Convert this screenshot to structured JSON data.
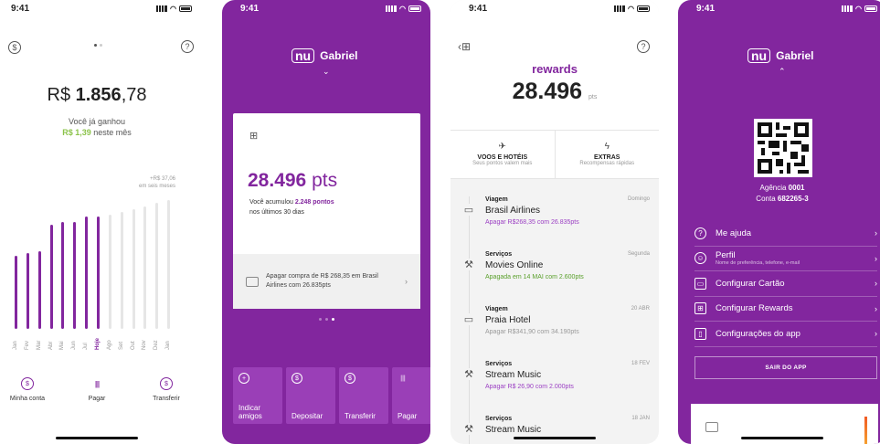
{
  "status_time": "9:41",
  "screen1": {
    "balance_prefix": "R$ ",
    "balance_int": "1.856",
    "balance_dec": ",78",
    "earned_label": "Você já ganhou",
    "earned_value": "R$ 1,39",
    "earned_suffix": " neste mês",
    "projection_value": "+R$ 37,06",
    "projection_label": "em seis meses",
    "months": [
      "Jan",
      "Fev",
      "Mar",
      "Abr",
      "Mai",
      "Jun",
      "Jul",
      "Hoje",
      "Ago",
      "Set",
      "Out",
      "Nov",
      "Dez",
      "Jan"
    ],
    "bar_levels": [
      0.5,
      0.52,
      0.53,
      0.71,
      0.73,
      0.73,
      0.77,
      0.77,
      0.78,
      0.8,
      0.82,
      0.84,
      0.86,
      0.88
    ],
    "actions": [
      {
        "label": "Minha conta",
        "icon": "wallet-icon",
        "glyph": "$"
      },
      {
        "label": "Pagar",
        "icon": "barcode-icon",
        "glyph": "||||"
      },
      {
        "label": "Transferir",
        "icon": "transfer-icon",
        "glyph": "$"
      }
    ]
  },
  "screen2": {
    "name": "Gabriel",
    "points": "28.496",
    "points_unit": "pts",
    "accum_prefix": "Você acumulou ",
    "accum_value": "2.248 pontos",
    "accum_suffix": "nos últimos 30 dias",
    "footer_text": "Apagar compra de R$ 268,35 em Brasil Airlines com 26.835pts",
    "tiles": [
      {
        "label": "Indicar amigos",
        "icon": "add-user-icon"
      },
      {
        "label": "Depositar",
        "icon": "deposit-icon"
      },
      {
        "label": "Transferir",
        "icon": "transfer-icon"
      },
      {
        "label": "Pagar",
        "icon": "barcode-icon"
      }
    ]
  },
  "screen3": {
    "title": "rewards",
    "points": "28.496",
    "points_unit": "pts",
    "categories": [
      {
        "title": "VOOS E HOTÉIS",
        "sub": "Seus pontos valem mais",
        "icon": "airplane-icon",
        "glyph": "✈"
      },
      {
        "title": "EXTRAS",
        "sub": "Recompensas rápidas",
        "icon": "lightning-icon",
        "glyph": "ϟ"
      }
    ],
    "feed": [
      {
        "category": "Viagem",
        "name": "Brasil Airlines",
        "detail": "Apagar R$268,35 com 26.835pts",
        "date": "Domingo",
        "tone": "purple",
        "icon": "suitcase-icon"
      },
      {
        "category": "Serviços",
        "name": "Movies Online",
        "detail": "Apagada em 14 MAI com 2.600pts",
        "date": "Segunda",
        "tone": "green",
        "icon": "tools-icon"
      },
      {
        "category": "Viagem",
        "name": "Praia Hotel",
        "detail": "Apagar R$341,90 com 34.190pts",
        "date": "20 ABR",
        "tone": "gray",
        "icon": "suitcase-icon"
      },
      {
        "category": "Serviços",
        "name": "Stream Music",
        "detail": "Apagar R$ 26,90 com 2.000pts",
        "date": "18 FEV",
        "tone": "purple",
        "icon": "tools-icon"
      },
      {
        "category": "Serviços",
        "name": "Stream Music",
        "detail": "",
        "date": "18 JAN",
        "tone": "gray",
        "icon": "tools-icon"
      }
    ]
  },
  "screen4": {
    "name": "Gabriel",
    "agency_label": "Agência ",
    "agency": "0001",
    "account_label": "Conta ",
    "account": "682265-3",
    "menu": [
      {
        "label": "Me ajuda",
        "sub": "",
        "icon": "help-icon",
        "glyph": "?"
      },
      {
        "label": "Perfil",
        "sub": "Nome de preferência, telefone, e-mail",
        "icon": "profile-icon",
        "glyph": "☺"
      },
      {
        "label": "Configurar Cartão",
        "sub": "",
        "icon": "card-icon",
        "glyph": "▭"
      },
      {
        "label": "Configurar Rewards",
        "sub": "",
        "icon": "gift-icon",
        "glyph": "⊞"
      },
      {
        "label": "Configurações do app",
        "sub": "",
        "icon": "phone-icon",
        "glyph": "▯"
      }
    ],
    "logout": "SAIR DO APP"
  },
  "colors": {
    "purple": "#82269e",
    "green": "#8bc34a",
    "accent_tile": "#9a3fb7"
  }
}
